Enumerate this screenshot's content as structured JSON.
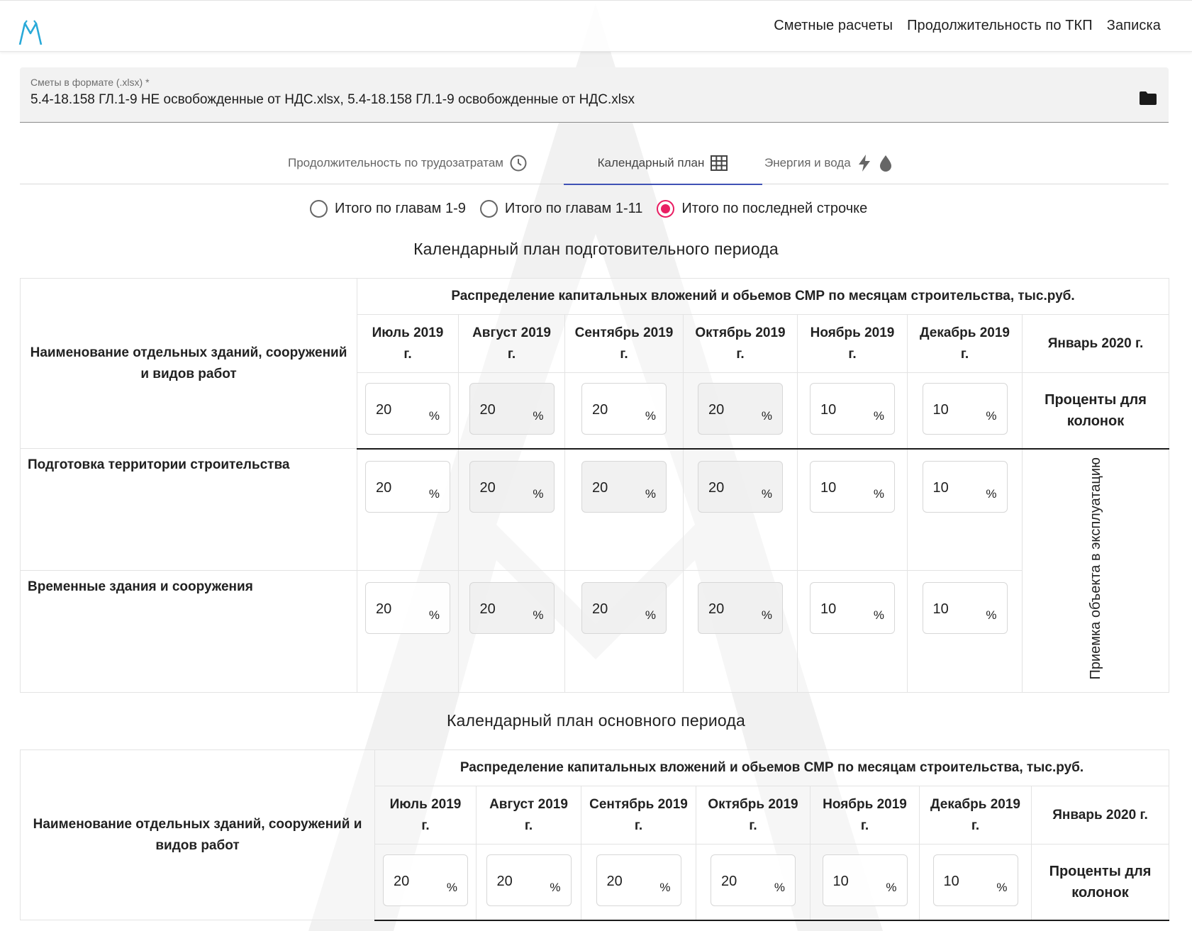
{
  "nav": {
    "items": [
      "Сметные расчеты",
      "Продолжительность по ТКП",
      "Записка"
    ]
  },
  "file_field": {
    "label": "Сметы в формате (.xlsx) *",
    "value": "5.4-18.158 ГЛ.1-9 НЕ освобожденные от НДС.xlsx, 5.4-18.158 ГЛ.1-9 освобожденные от НДС.xlsx",
    "icon": "folder-icon"
  },
  "tabs": [
    {
      "label": "Продолжительность по трудозатратам",
      "icon": "clock-icon",
      "active": false
    },
    {
      "label": "Календарный план",
      "icon": "grid-icon",
      "active": true
    },
    {
      "label": "Энергия и вода",
      "icon": "bolt-and-drop-icon",
      "active": false
    }
  ],
  "radios": [
    {
      "label": "Итого по главам 1-9",
      "checked": false
    },
    {
      "label": "Итого по главам 1-11",
      "checked": false
    },
    {
      "label": "Итого по последней строчке",
      "checked": true
    }
  ],
  "colors": {
    "accent": "#e91e63",
    "tab_indicator": "#3f51b5"
  },
  "prep": {
    "title": "Календарный план подготовительного периода",
    "name_header": "Наименование отдельных зданий, сооружений и видов работ",
    "dist_header": "Распределение капитальных вложений и обьемов СМР по месяцам строительства, тыс.руб.",
    "months": [
      [
        "Июль 2019",
        "г."
      ],
      [
        "Август 2019",
        "г."
      ],
      [
        "Сентябрь 2019",
        "г."
      ],
      [
        "Октябрь 2019",
        "г."
      ],
      [
        "Ноябрь 2019",
        "г."
      ],
      [
        "Декабрь 2019",
        "г."
      ]
    ],
    "last_month": "Январь 2020 г.",
    "column_percents": [
      "20",
      "20",
      "20",
      "20",
      "10",
      "10"
    ],
    "column_percents_label": "Проценты для колонок",
    "percent_sign": "%",
    "rows": [
      {
        "name": "Подготовка территории строительства",
        "values": [
          "20",
          "20",
          "20",
          "20",
          "10",
          "10"
        ]
      },
      {
        "name": "Временные здания и сооружения",
        "values": [
          "20",
          "20",
          "20",
          "20",
          "10",
          "10"
        ]
      }
    ],
    "acceptance": "Приемка объекта в эксплуатацию"
  },
  "main": {
    "title": "Календарный план основного периода",
    "name_header": "Наименование отдельных зданий, сооружений и видов работ",
    "dist_header": "Распределение капитальных вложений и обьемов СМР по месяцам строительства, тыс.руб.",
    "months": [
      [
        "Июль 2019",
        "г."
      ],
      [
        "Август 2019",
        "г."
      ],
      [
        "Сентябрь 2019",
        "г."
      ],
      [
        "Октябрь 2019",
        "г."
      ],
      [
        "Ноябрь 2019",
        "г."
      ],
      [
        "Декабрь 2019",
        "г."
      ]
    ],
    "last_month": "Январь 2020 г.",
    "column_percents": [
      "20",
      "20",
      "20",
      "20",
      "10",
      "10"
    ],
    "column_percents_label": "Проценты для колонок",
    "percent_sign": "%"
  }
}
